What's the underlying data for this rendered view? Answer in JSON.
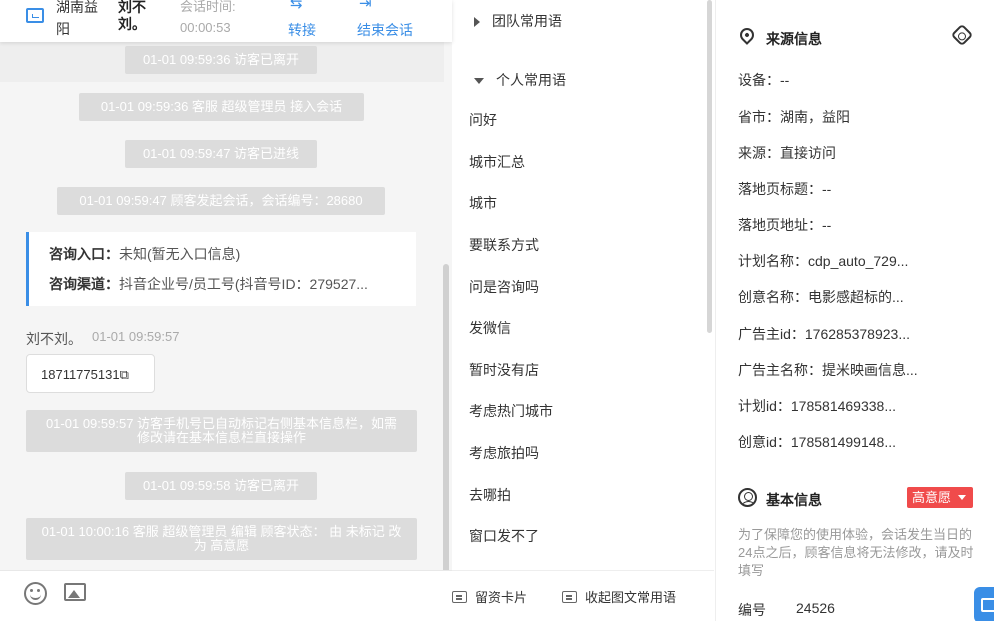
{
  "header": {
    "location": "湖南益阳",
    "visitor_name": "刘不刘。",
    "session_time_label": "会话时间:",
    "session_time": "00:00:53",
    "transfer_label": "转接",
    "end_session_label": "结束会话",
    "monitor_icon": "monitor-icon",
    "transfer_icon": "transfer-arrows-icon",
    "end_icon": "exit-icon"
  },
  "chat": {
    "system_messages": [
      "01-01 09:59:36 访客已离开",
      "01-01 09:59:36 客服 超级管理员 接入会话",
      "01-01 09:59:47 访客已进线",
      "01-01 09:59:47 顾客发起会话，会话编号：28680",
      "01-01 09:59:57 访客手机号已自动标记右侧基本信息栏，如需修改请在基本信息栏直接操作",
      "01-01 09:59:58 访客已离开",
      "01-01 10:00:16 客服 超级管理员 编辑 顾客状态： 由 未标记 改为 高意愿"
    ],
    "info_card": {
      "entry_label": "咨询入口：",
      "entry_value": "未知(暂无入口信息)",
      "channel_label": "咨询渠道：",
      "channel_value": "抖音企业号/员工号(抖音号ID：279527..."
    },
    "message": {
      "sender": "刘不刘。",
      "time": "01-01 09:59:57",
      "text": "18711775131"
    }
  },
  "phrases": {
    "team_group": "团队常用语",
    "personal_group": "个人常用语",
    "items": [
      "问好",
      "城市汇总",
      "城市",
      "要联系方式",
      "问是咨询吗",
      "发微信",
      "暂时没有店",
      "考虑热门城市",
      "考虑旅拍吗",
      "去哪拍",
      "窗口发不了"
    ],
    "toolbar": {
      "card_label": "留资卡片",
      "collapse_label": "收起图文常用语"
    }
  },
  "source_info": {
    "title": "来源信息",
    "rows": [
      "设备：--",
      "省市：湖南，益阳",
      "来源：直接访问",
      "落地页标题：--",
      "落地页地址：--",
      "计划名称：cdp_auto_729...",
      "创意名称：电影感超标的...",
      "广告主id：176285378923...",
      "广告主名称：提米映画信息...",
      "计划id：178581469338...",
      "创意id：178581499148..."
    ]
  },
  "basic_info": {
    "title": "基本信息",
    "intent_badge": "高意愿",
    "notice": "为了保障您的使用体验，会话发生当日的24点之后，顾客信息将无法修改，请及时填写",
    "id_label": "编号",
    "id_value": "24526"
  }
}
